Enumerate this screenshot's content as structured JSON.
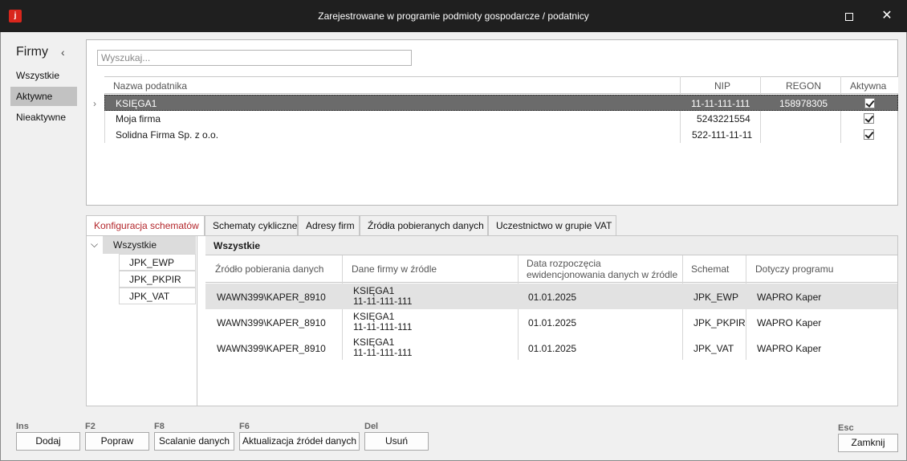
{
  "window": {
    "title": "Zarejestrowane w programie podmioty gospodarcze / podatnicy",
    "app_icon": "j",
    "maximize_icon": "maximize-icon",
    "close_glyph": "✕"
  },
  "nav": {
    "title": "Firmy",
    "collapse_glyph": "‹",
    "items": [
      {
        "label": "Wszystkie"
      },
      {
        "label": "Aktywne",
        "active": true
      },
      {
        "label": "Nieaktywne"
      }
    ]
  },
  "companies": {
    "search_placeholder": "Wyszukaj...",
    "columns": {
      "name": "Nazwa podatnika",
      "nip": "NIP",
      "regon": "REGON",
      "active": "Aktywna"
    },
    "rows": [
      {
        "name": "KSIĘGA1",
        "nip": "11-11-111-111",
        "regon": "158978305",
        "active": true,
        "selected": true
      },
      {
        "name": "Moja firma",
        "nip": "5243221554",
        "regon": "",
        "active": true
      },
      {
        "name": "Solidna Firma Sp. z o.o.",
        "nip": "522-111-11-11",
        "regon": "",
        "active": true
      }
    ]
  },
  "tabs": [
    {
      "label": "Konfiguracja schematów",
      "active": true
    },
    {
      "label": "Schematy cykliczne"
    },
    {
      "label": "Adresy firm"
    },
    {
      "label": "Źródła pobieranych danych"
    },
    {
      "label": "Uczestnictwo w grupie VAT"
    }
  ],
  "tree": {
    "root": "Wszystkie",
    "children": [
      "JPK_EWP",
      "JPK_PKPIR",
      "JPK_VAT"
    ]
  },
  "schema": {
    "title": "Wszystkie",
    "columns": {
      "source": "Źródło pobierania danych",
      "company": "Dane firmy w źródle",
      "date_line1": "Data rozpoczęcia",
      "date_line2": "ewidencjonowania danych w źródle",
      "schema": "Schemat",
      "program": "Dotyczy programu"
    },
    "rows": [
      {
        "source": "WAWN399\\KAPER_8910",
        "company_name": "KSIĘGA1",
        "company_nip": "11-11-111-111",
        "date": "01.01.2025",
        "schema": "JPK_EWP",
        "program": "WAPRO Kaper"
      },
      {
        "source": "WAWN399\\KAPER_8910",
        "company_name": "KSIĘGA1",
        "company_nip": "11-11-111-111",
        "date": "01.01.2025",
        "schema": "JPK_PKPIR",
        "program": "WAPRO Kaper"
      },
      {
        "source": "WAWN399\\KAPER_8910",
        "company_name": "KSIĘGA1",
        "company_nip": "11-11-111-111",
        "date": "01.01.2025",
        "schema": "JPK_VAT",
        "program": "WAPRO Kaper"
      }
    ]
  },
  "toolbar": {
    "add": {
      "key": "Ins",
      "label": "Dodaj"
    },
    "edit": {
      "key": "F2",
      "label": "Popraw"
    },
    "merge": {
      "key": "F8",
      "label": "Scalanie danych"
    },
    "update": {
      "key": "F6",
      "label": "Aktualizacja źródeł danych"
    },
    "delete": {
      "key": "Del",
      "label": "Usuń"
    },
    "close": {
      "key": "Esc",
      "label": "Zamknij"
    }
  }
}
